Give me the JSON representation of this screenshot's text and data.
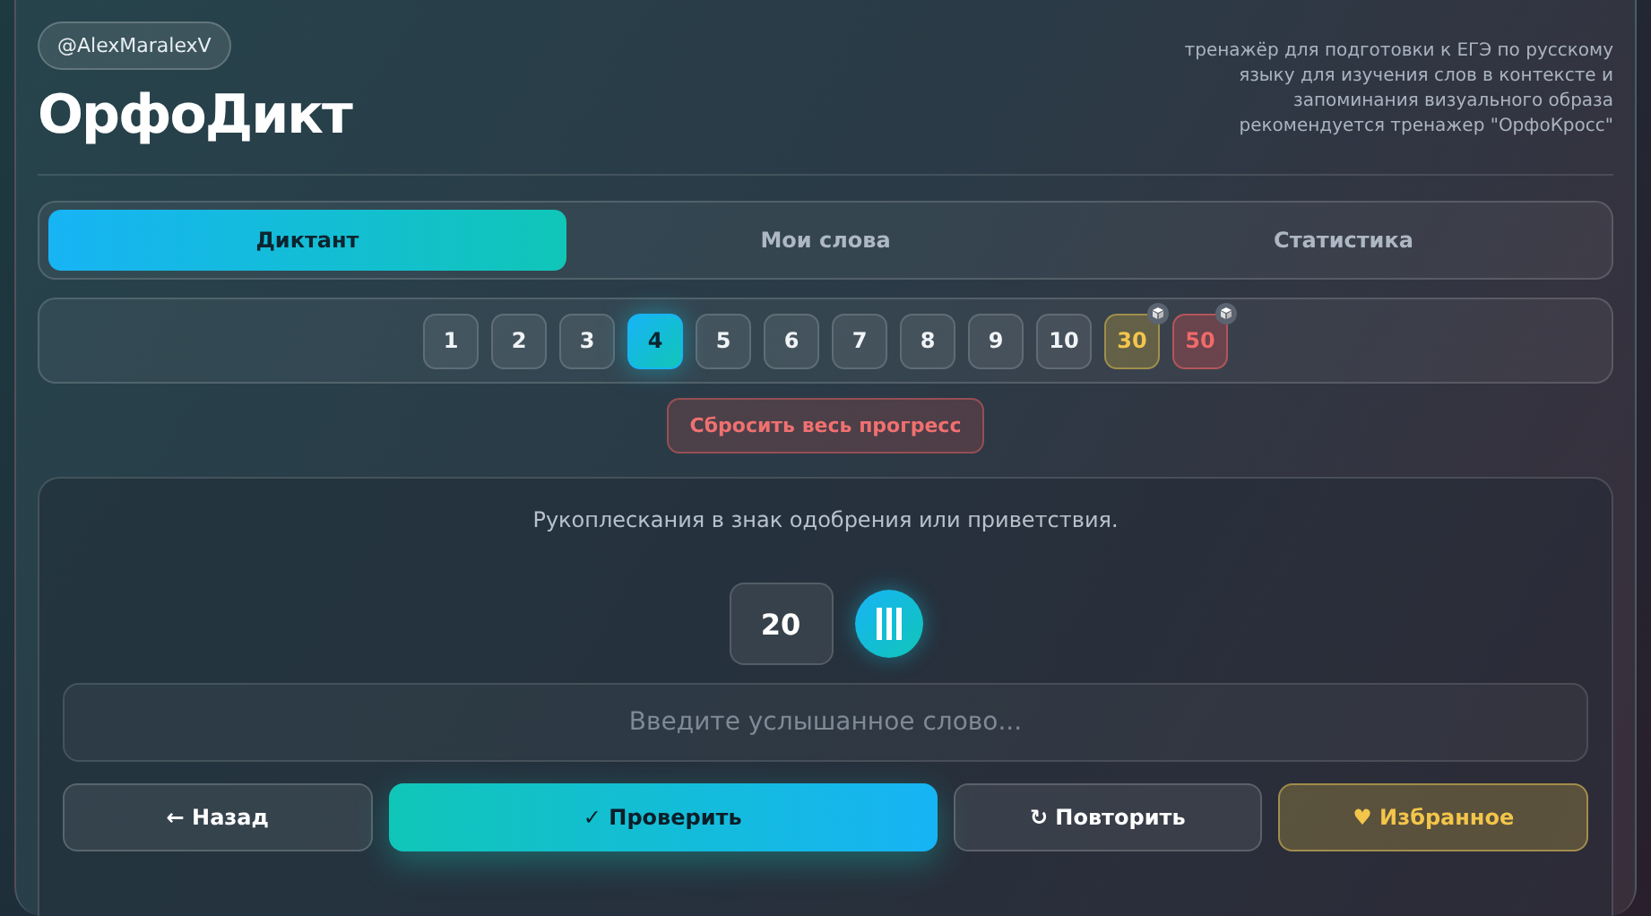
{
  "header": {
    "author_tag": "@AlexMaralexV",
    "title": "ОрфоДикт",
    "description": "тренажёр для подготовки к ЕГЭ по русскому языку для изучения слов в контексте и запоминания визуального образа рекомендуется тренажер \"ОрфоКросс\""
  },
  "tabs": [
    {
      "label": "Диктант",
      "selected": true
    },
    {
      "label": "Мои слова",
      "selected": false
    },
    {
      "label": "Статистика",
      "selected": false
    }
  ],
  "levels": [
    {
      "label": "1",
      "kind": "plain",
      "selected": false
    },
    {
      "label": "2",
      "kind": "plain",
      "selected": false
    },
    {
      "label": "3",
      "kind": "plain",
      "selected": false
    },
    {
      "label": "4",
      "kind": "plain",
      "selected": true
    },
    {
      "label": "5",
      "kind": "plain",
      "selected": false
    },
    {
      "label": "6",
      "kind": "plain",
      "selected": false
    },
    {
      "label": "7",
      "kind": "plain",
      "selected": false
    },
    {
      "label": "8",
      "kind": "plain",
      "selected": false
    },
    {
      "label": "9",
      "kind": "plain",
      "selected": false
    },
    {
      "label": "10",
      "kind": "plain",
      "selected": false
    },
    {
      "label": "30",
      "kind": "gold",
      "selected": false
    },
    {
      "label": "50",
      "kind": "red",
      "selected": false
    }
  ],
  "reset_button": "Сбросить весь прогресс",
  "dictation": {
    "definition": "Рукоплескания в знак одобрения или приветствия.",
    "counter": "20",
    "answer": {
      "placeholder": "Введите услышанное слово..."
    },
    "buttons": [
      {
        "label": "← Назад",
        "kind": "dark"
      },
      {
        "label": "✓ Проверить",
        "kind": "primary"
      },
      {
        "label": "↻ Повторить",
        "kind": "dark"
      },
      {
        "label": "♥ Избранное",
        "kind": "gold"
      }
    ]
  }
}
